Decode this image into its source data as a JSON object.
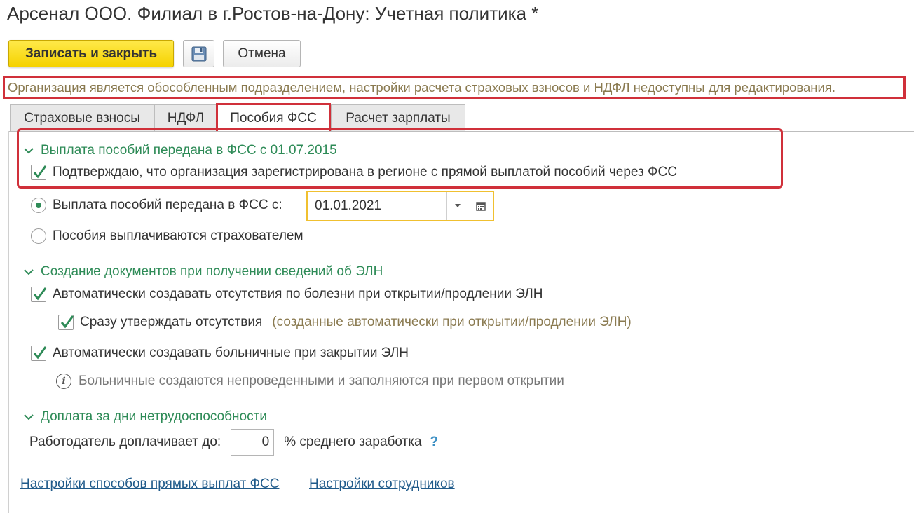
{
  "window": {
    "title": "Арсенал ООО. Филиал в г.Ростов-на-Дону: Учетная политика *"
  },
  "toolbar": {
    "save_close_label": "Записать и закрыть",
    "save_icon": "floppy-disk-icon",
    "cancel_label": "Отмена"
  },
  "notice": {
    "text": "Организация является обособленным подразделением, настройки расчета страховых взносов и НДФЛ недоступны для редактирования."
  },
  "tabs": [
    {
      "label": "Страховые взносы",
      "active": false
    },
    {
      "label": "НДФЛ",
      "active": false
    },
    {
      "label": "Пособия ФСС",
      "active": true
    },
    {
      "label": "Расчет зарплаты",
      "active": false
    }
  ],
  "fss_section": {
    "header": "Выплата пособий передана в ФСС с 01.07.2015",
    "confirm_checkbox": {
      "label": "Подтверждаю, что организация зарегистрирована в регионе с прямой выплатой пособий через ФСС",
      "checked": true
    },
    "radio_transferred": {
      "label": "Выплата пособий передана в ФСС с:",
      "checked": true
    },
    "date_value": "01.01.2021",
    "radio_employer": {
      "label": "Пособия выплачиваются страхователем",
      "checked": false
    }
  },
  "eln_section": {
    "header": "Создание документов при получении сведений об ЭЛН",
    "auto_absence": {
      "label": "Автоматически создавать отсутствия по болезни при открытии/продлении ЭЛН",
      "checked": true
    },
    "approve_absence": {
      "label": "Сразу утверждать отсутствия",
      "hint": "(созданные автоматически при открытии/продлении ЭЛН)",
      "checked": true
    },
    "auto_sick_leave": {
      "label": "Автоматически создавать больничные при закрытии ЭЛН",
      "checked": true
    },
    "info_text": "Больничные создаются непроведенными и заполняются при первом открытии"
  },
  "surcharge_section": {
    "header": "Доплата за дни нетрудоспособности",
    "employer_label": "Работодатель доплачивает до:",
    "value": "0",
    "suffix": "% среднего заработка",
    "help": "?"
  },
  "links": {
    "direct_payments": "Настройки способов прямых выплат ФСС",
    "employee_settings": "Настройки сотрудников"
  },
  "colors": {
    "accent_yellow": "#f5d200",
    "group_green": "#2e8b57",
    "highlight_red": "#d0303a",
    "notice_text": "#8a7a50",
    "link_blue": "#1f5a8a"
  }
}
